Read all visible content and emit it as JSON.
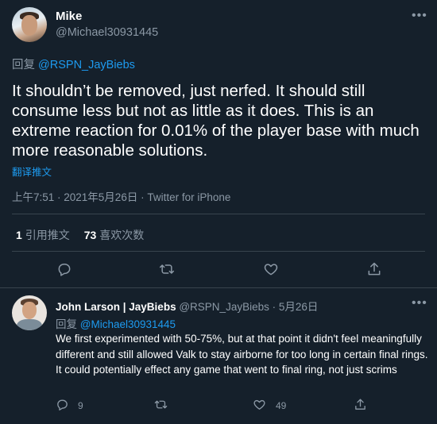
{
  "main_tweet": {
    "name": "Mike",
    "handle": "@Michael30931445",
    "reply_prefix": "回复",
    "reply_to": "@RSPN_JayBiebs",
    "text": "It shouldn’t be removed, just nerfed. It should still consume less but not as little as it does. This is an extreme reaction for 0.01% of the player base with much more reasonable solutions.",
    "translate": "翻译推文",
    "meta": "上午7:51 · 2021年5月26日 · Twitter for iPhone",
    "quote_count": "1",
    "quote_label": "引用推文",
    "like_count": "73",
    "like_label": "喜欢次数",
    "more_icon": "more-dots-icon",
    "action_icons": [
      "reply-icon",
      "retweet-icon",
      "like-icon",
      "share-icon"
    ]
  },
  "reply_tweet": {
    "name": "John Larson | JayBiebs",
    "handle": "@RSPN_JayBiebs",
    "sep": "·",
    "date": "5月26日",
    "reply_prefix": "回复",
    "reply_to": "@Michael30931445",
    "text": "We first experimented with 50-75%, but at that point it didn't feel meaningfully different and still allowed Valk to stay airborne for too long in certain final rings. It could potentially effect any game that went to final ring, not just scrims",
    "reply_count": "9",
    "like_count": "49",
    "more_icon": "more-dots-icon"
  },
  "colors": {
    "background": "#15202b",
    "link": "#1d9bf0",
    "muted": "#8b98a5",
    "divider": "#38444d"
  }
}
